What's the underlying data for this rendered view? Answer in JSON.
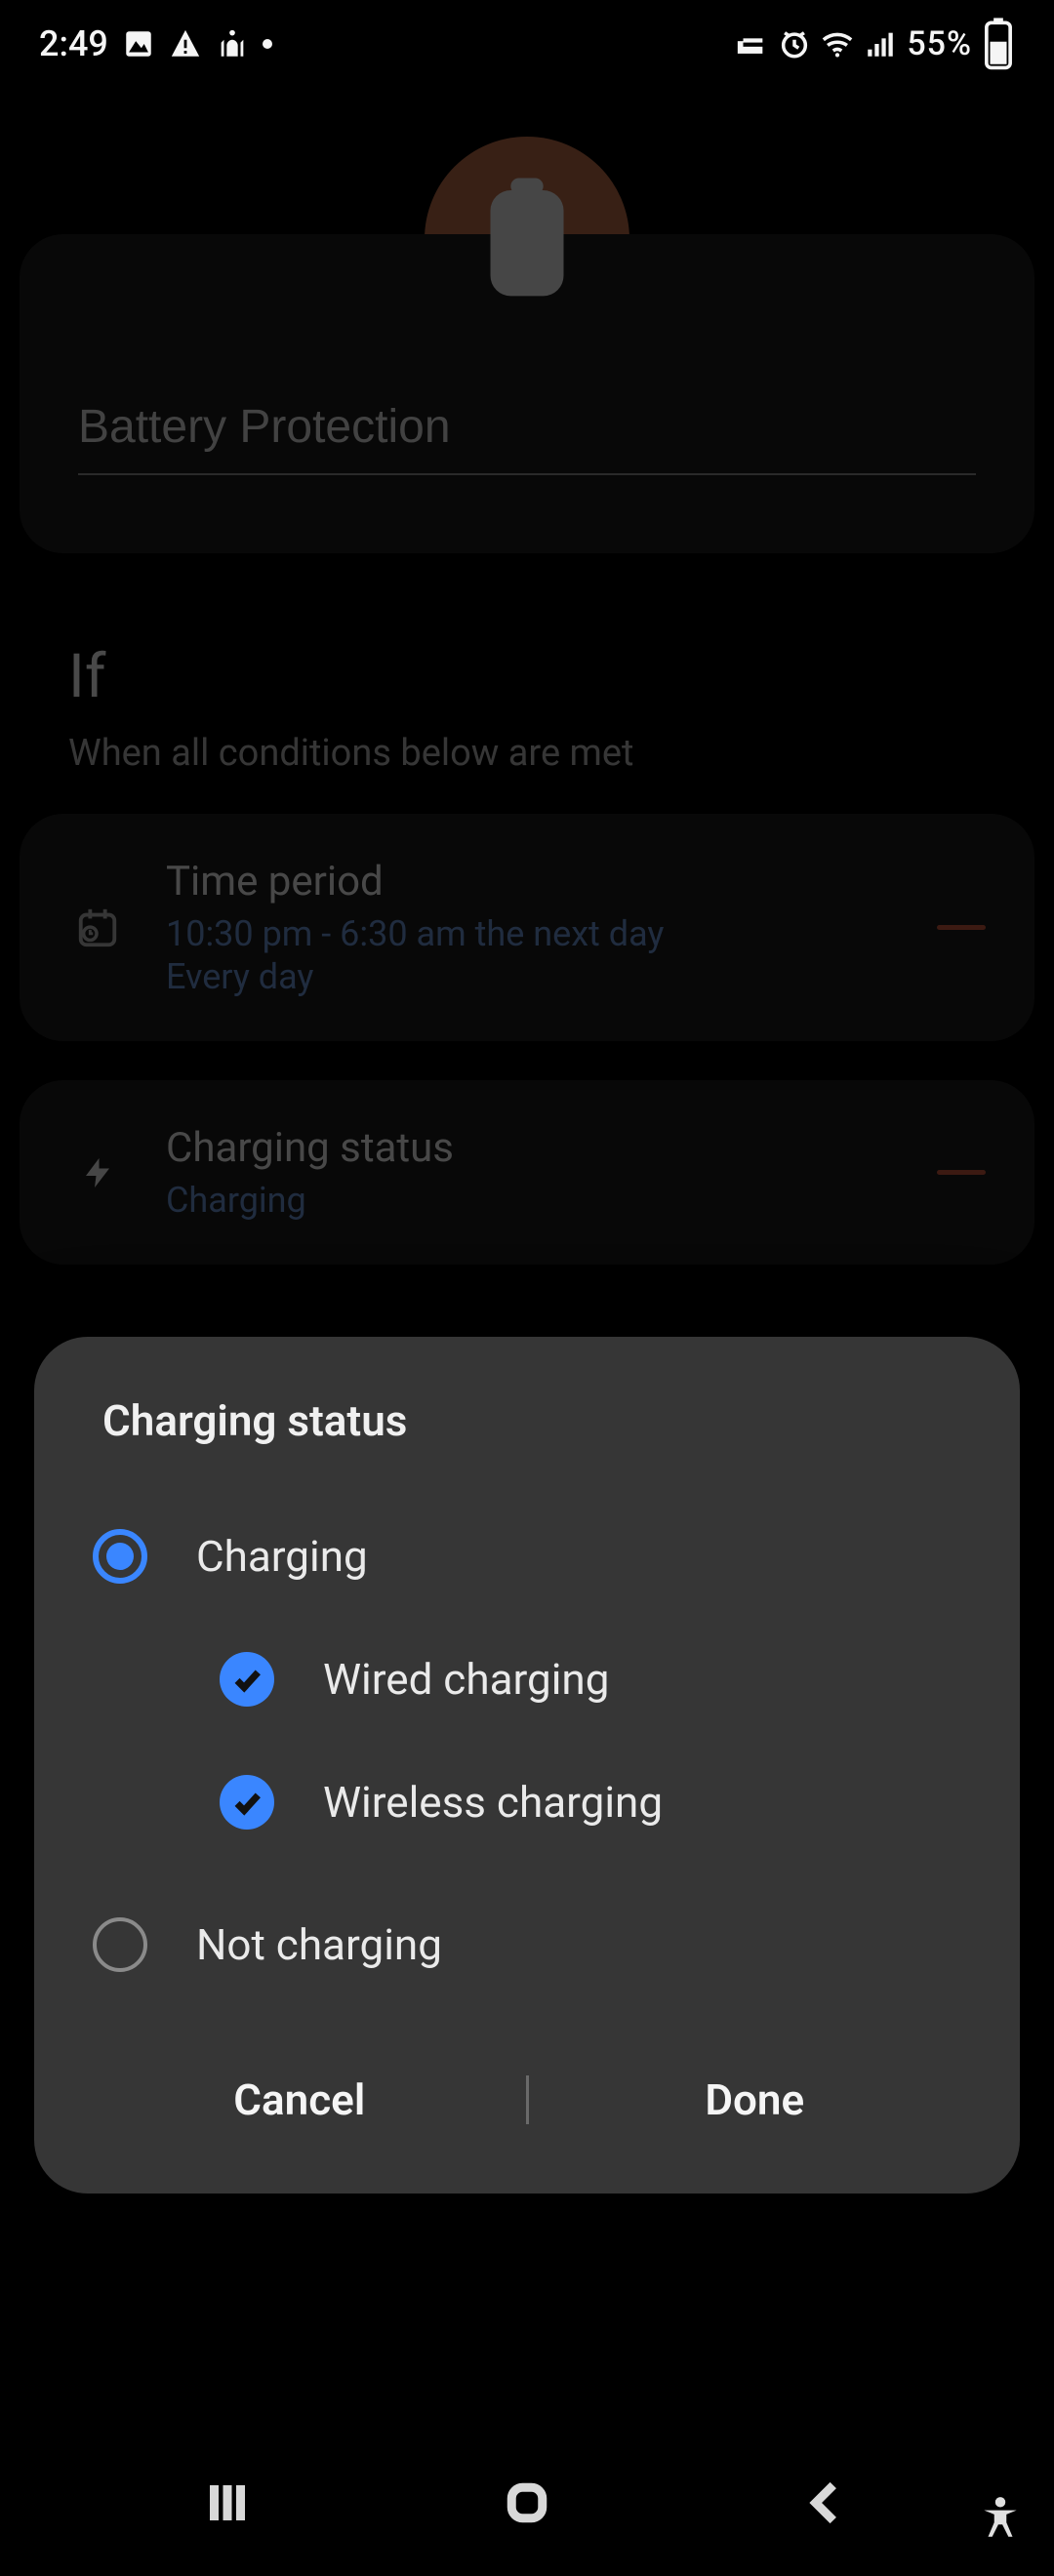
{
  "status": {
    "time": "2:49",
    "battery": "55%"
  },
  "page": {
    "title_value": "Battery Protection",
    "section_if": "If",
    "section_if_sub": "When all conditions below are met"
  },
  "conditions": {
    "time": {
      "title": "Time period",
      "line1": "10:30  pm - 6:30  am the next day",
      "line2": "Every day"
    },
    "charging": {
      "title": "Charging status",
      "value": "Charging"
    }
  },
  "dialog": {
    "title": "Charging status",
    "options": {
      "charging": "Charging",
      "wired": "Wired charging",
      "wireless": "Wireless charging",
      "not_charging": "Not charging"
    },
    "buttons": {
      "cancel": "Cancel",
      "done": "Done"
    }
  }
}
